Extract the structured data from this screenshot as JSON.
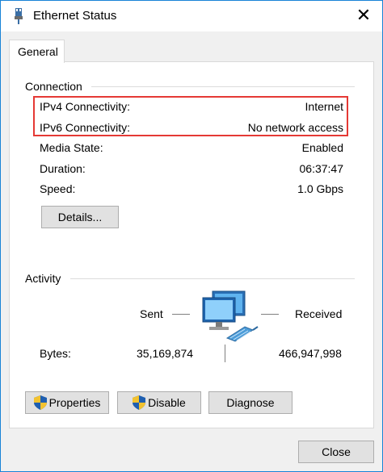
{
  "window": {
    "title": "Ethernet Status",
    "close_glyph": "✕"
  },
  "tabs": [
    {
      "label": "General"
    }
  ],
  "connection": {
    "label": "Connection",
    "rows": [
      {
        "label": "IPv4 Connectivity:",
        "value": "Internet"
      },
      {
        "label": "IPv6 Connectivity:",
        "value": "No network access"
      },
      {
        "label": "Media State:",
        "value": "Enabled"
      },
      {
        "label": "Duration:",
        "value": "06:37:47"
      },
      {
        "label": "Speed:",
        "value": "1.0 Gbps"
      }
    ],
    "details_button": "Details..."
  },
  "activity": {
    "label": "Activity",
    "sent_label": "Sent",
    "received_label": "Received",
    "bytes_label": "Bytes:",
    "bytes_sent": "35,169,874",
    "bytes_received": "466,947,998"
  },
  "buttons": {
    "properties": "Properties",
    "disable": "Disable",
    "diagnose": "Diagnose",
    "close": "Close"
  },
  "icons": {
    "title": "ethernet-cable-icon",
    "network": "network-computers-icon",
    "shield": "uac-shield-icon"
  },
  "colors": {
    "window_border": "#1883d7",
    "highlight": "#e53935",
    "button_bg": "#e1e1e1"
  }
}
